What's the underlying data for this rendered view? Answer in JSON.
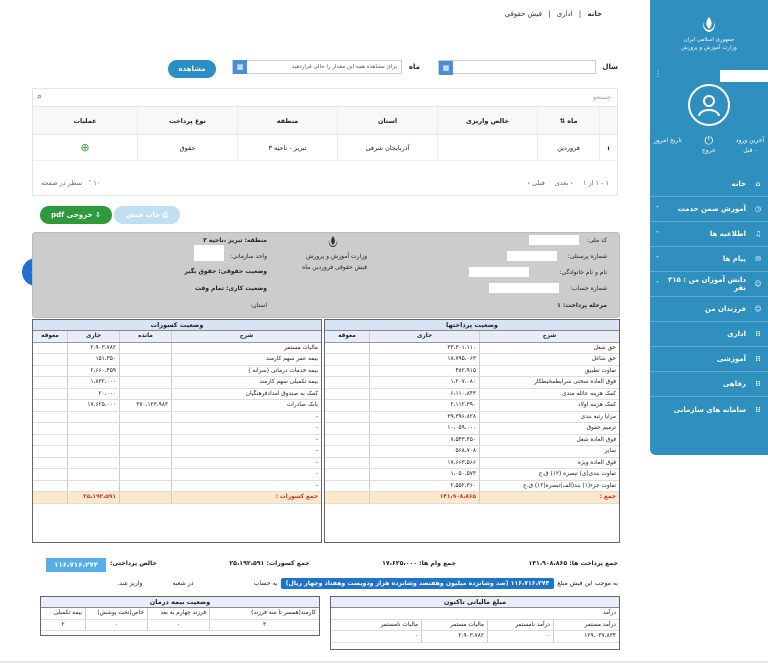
{
  "breadcrumb": {
    "home": "خانه",
    "sep1": "|",
    "admin": "اداری",
    "sep2": "|",
    "page": "فیش حقوقی"
  },
  "sidebar": {
    "org_line1": "جمهوری اسلامی ایران",
    "org_line2": "وزارت آموزش و پرورش",
    "login_label": "آخرین ورود",
    "login_sub": "- قبل",
    "logout_label": "خروج",
    "today_label": "تاریخ امروز",
    "items": [
      {
        "label": "خانه",
        "icon": "home-icon"
      },
      {
        "label": "آموزش ضمن خدمت",
        "icon": "clock-icon"
      },
      {
        "label": "اطلاعیه ها",
        "icon": "bell-icon"
      },
      {
        "label": "پیام ها",
        "icon": "mail-icon"
      },
      {
        "label": "دانش آموزان من : ۳۱۵ نفر",
        "icon": "students-icon"
      },
      {
        "label": "فرزندان من",
        "icon": "children-icon"
      },
      {
        "label": "اداری",
        "icon": "grid-icon"
      },
      {
        "label": "آموزشی",
        "icon": "grid-icon"
      },
      {
        "label": "رفاهی",
        "icon": "grid-icon"
      },
      {
        "label": "سامانه های سازمانی",
        "icon": "grid-icon"
      }
    ]
  },
  "filter": {
    "year_label": "سال",
    "month_label": "ماه",
    "month_placeholder": "برای مشاهده همه این مقدار را خالی قراردهید",
    "show_button": "مشاهده"
  },
  "grid": {
    "search_placeholder": "جستجو",
    "headers": [
      "ماه",
      "خالص واریزی",
      "استان",
      "منطقه",
      "نوع پرداخت",
      "عملیات"
    ],
    "rows": [
      {
        "month": "فروردین",
        "net": "",
        "province": "آذربایجان شرقی",
        "region": "تبریز - ناحیه ۳",
        "type": "حقوق"
      }
    ],
    "pager_range": "۱ - ۱ از ۱",
    "pager_next": "بعدی",
    "pager_prev": "قبلی",
    "rows_per_page_label": "سطر در صفحه",
    "rows_per_page": "۱۰"
  },
  "actions": {
    "print": "چاپ فیش",
    "pdf": "خروجی pdf"
  },
  "fish": {
    "code_melli": "کد ملی:",
    "personnel_no": "شماره پرسنلی:",
    "full_name": "نام و نام خانوادگی:",
    "account_no": "شماره حساب:",
    "payment_stage": "مرحله پرداخت: ۱",
    "ministry": "وزارت آموزش و پرورش",
    "title": "فیش حقوقی فروردین ماه",
    "region": "منطقه: تبریز ،ناحیه ۳",
    "unit": "واحد سازمانی:",
    "salary_status": "وضعیت حقوقی: حقوق بگیر",
    "work_status": "وضعیت کاری: تمام وقت",
    "province": "استان:"
  },
  "payments": {
    "title": "وضعیت پرداختها",
    "headers": [
      "شرح",
      "جاری",
      "معوقه"
    ],
    "rows": [
      [
        "حق شغل",
        "۳۳،۳۰۱،۱۱۰",
        ""
      ],
      [
        "حق شاغل",
        "۱۸،۷۹۵،۰۶۳",
        ""
      ],
      [
        "تفاوت تطبیق",
        "۴۸۲،۹۱۵",
        ""
      ],
      [
        "فوق العاده سختی شرایطمحیطکار",
        "۱،۲۰۷،۰۸۰",
        ""
      ],
      [
        "کمک هزینه عائله مندی",
        "۶،۱۱۰،۸۴۳",
        ""
      ],
      [
        "کمک هزینه اولاد",
        "۲،۱۱۲،۳۹۰",
        ""
      ],
      [
        "مزایا رتبه بندی",
        "۳۹،۳۹۶،۸۲۸",
        ""
      ],
      [
        "ترمیم حقوق",
        "۱۰،۰۵۹،۰۰۰",
        ""
      ],
      [
        "فوق العاده شغل",
        "۷،۵۴۳،۴۵۰",
        ""
      ],
      [
        "سایر",
        "۵۶۸،۷۰۸",
        ""
      ],
      [
        "فوق العاده ویژه",
        "۱۷،۶۶۳،۵۶۶",
        ""
      ],
      [
        "تفاوت بندی(ی) تبصره (۱۲) ق.ج",
        "۱،۰۵۰،۵۷۳",
        ""
      ],
      [
        "تفاوت جزء(۱) بند(الف)تبصره(۱۲) ق.ج",
        "۲،۵۵۲،۳۶۰",
        ""
      ]
    ],
    "total_label": "جمع :",
    "total": "۱۴۱،۹۰۸،۸۶۵"
  },
  "deductions": {
    "title": "وضعیت کسورات",
    "headers": [
      "شرح",
      "مانده",
      "جاری",
      "معوقه"
    ],
    "rows": [
      [
        "مالیات مستمر",
        "",
        "۲،۹۰۳،۷۸۲",
        ""
      ],
      [
        "بیمه عمر سهم کارمند",
        "",
        "۱۵۱،۳۵۰",
        ""
      ],
      [
        "بیمه خدمات درمانی (سرانه )",
        "",
        "۲،۶۶۰،۴۵۹",
        ""
      ],
      [
        "بیمه تکمیلی سهم کارمند",
        "",
        "۱،۸۳۲،۰۰۰",
        ""
      ],
      [
        "کمک به صندوق امدادفرهنگیان",
        "",
        "۲۰،۰۰۰",
        ""
      ],
      [
        "بانک صادرات",
        "۳۷۰،۱۲۳،۹۸۳",
        "۱۷،۶۲۵،۰۰۰",
        ""
      ],
      [
        "-",
        "",
        "",
        ""
      ],
      [
        "-",
        "",
        "",
        ""
      ],
      [
        "-",
        "",
        "",
        ""
      ],
      [
        "-",
        "",
        "",
        ""
      ],
      [
        "-",
        "",
        "",
        ""
      ],
      [
        "-",
        "",
        "",
        ""
      ],
      [
        "-",
        "",
        "",
        ""
      ]
    ],
    "total_label": "جمع کسورات :",
    "total": "۲۵،۱۹۲،۵۹۱"
  },
  "summary": {
    "payments_total": "جمع پرداخت ها: ۱۴۱،۹۰۸،۸۶۵",
    "loans_total": "جمع وام ها: ۱۷،۶۲۵،۰۰۰",
    "deductions_total": "جمع کسورات: ۲۵،۱۹۲،۵۹۱",
    "net_label": "خالص پرداختی:",
    "net_value": "۱۱۶،۷۱۶،۲۷۴",
    "words_prefix": "به موجب این فیش مبلغ",
    "words_amount": "۱۱۶،۷۱۶،۲۷۴ (صد وشانزده میلیون وهفتصد وشانزده هزار ودویست وهفتاد وچهار ریال)",
    "words_suffix": "به حساب",
    "branch_text": "در شعبه",
    "deposit_text": "واریز شد."
  },
  "tax": {
    "title": "مبلغ مالیاتی تاکنون",
    "headers": [
      "درآمد",
      "درآمد مستمر",
      "درآمد نامستمر",
      "مالیات مستمر",
      "مالیات نامستمر"
    ],
    "row": [
      "",
      "۱۲۹،۰۳۷،۸۳۴",
      "۰",
      "۲،۹۰۳،۷۸۲",
      "۰"
    ]
  },
  "insurance": {
    "title": "وضعیت بیمه درمان",
    "headers": [
      "کارمند(همسر تا سه فرزند)",
      "فرزند چهارم به بعد",
      "خاص(تحت پوشش)",
      "بیمه تکمیلی"
    ],
    "row": [
      "۳",
      "۰",
      "۰",
      "۲"
    ]
  }
}
